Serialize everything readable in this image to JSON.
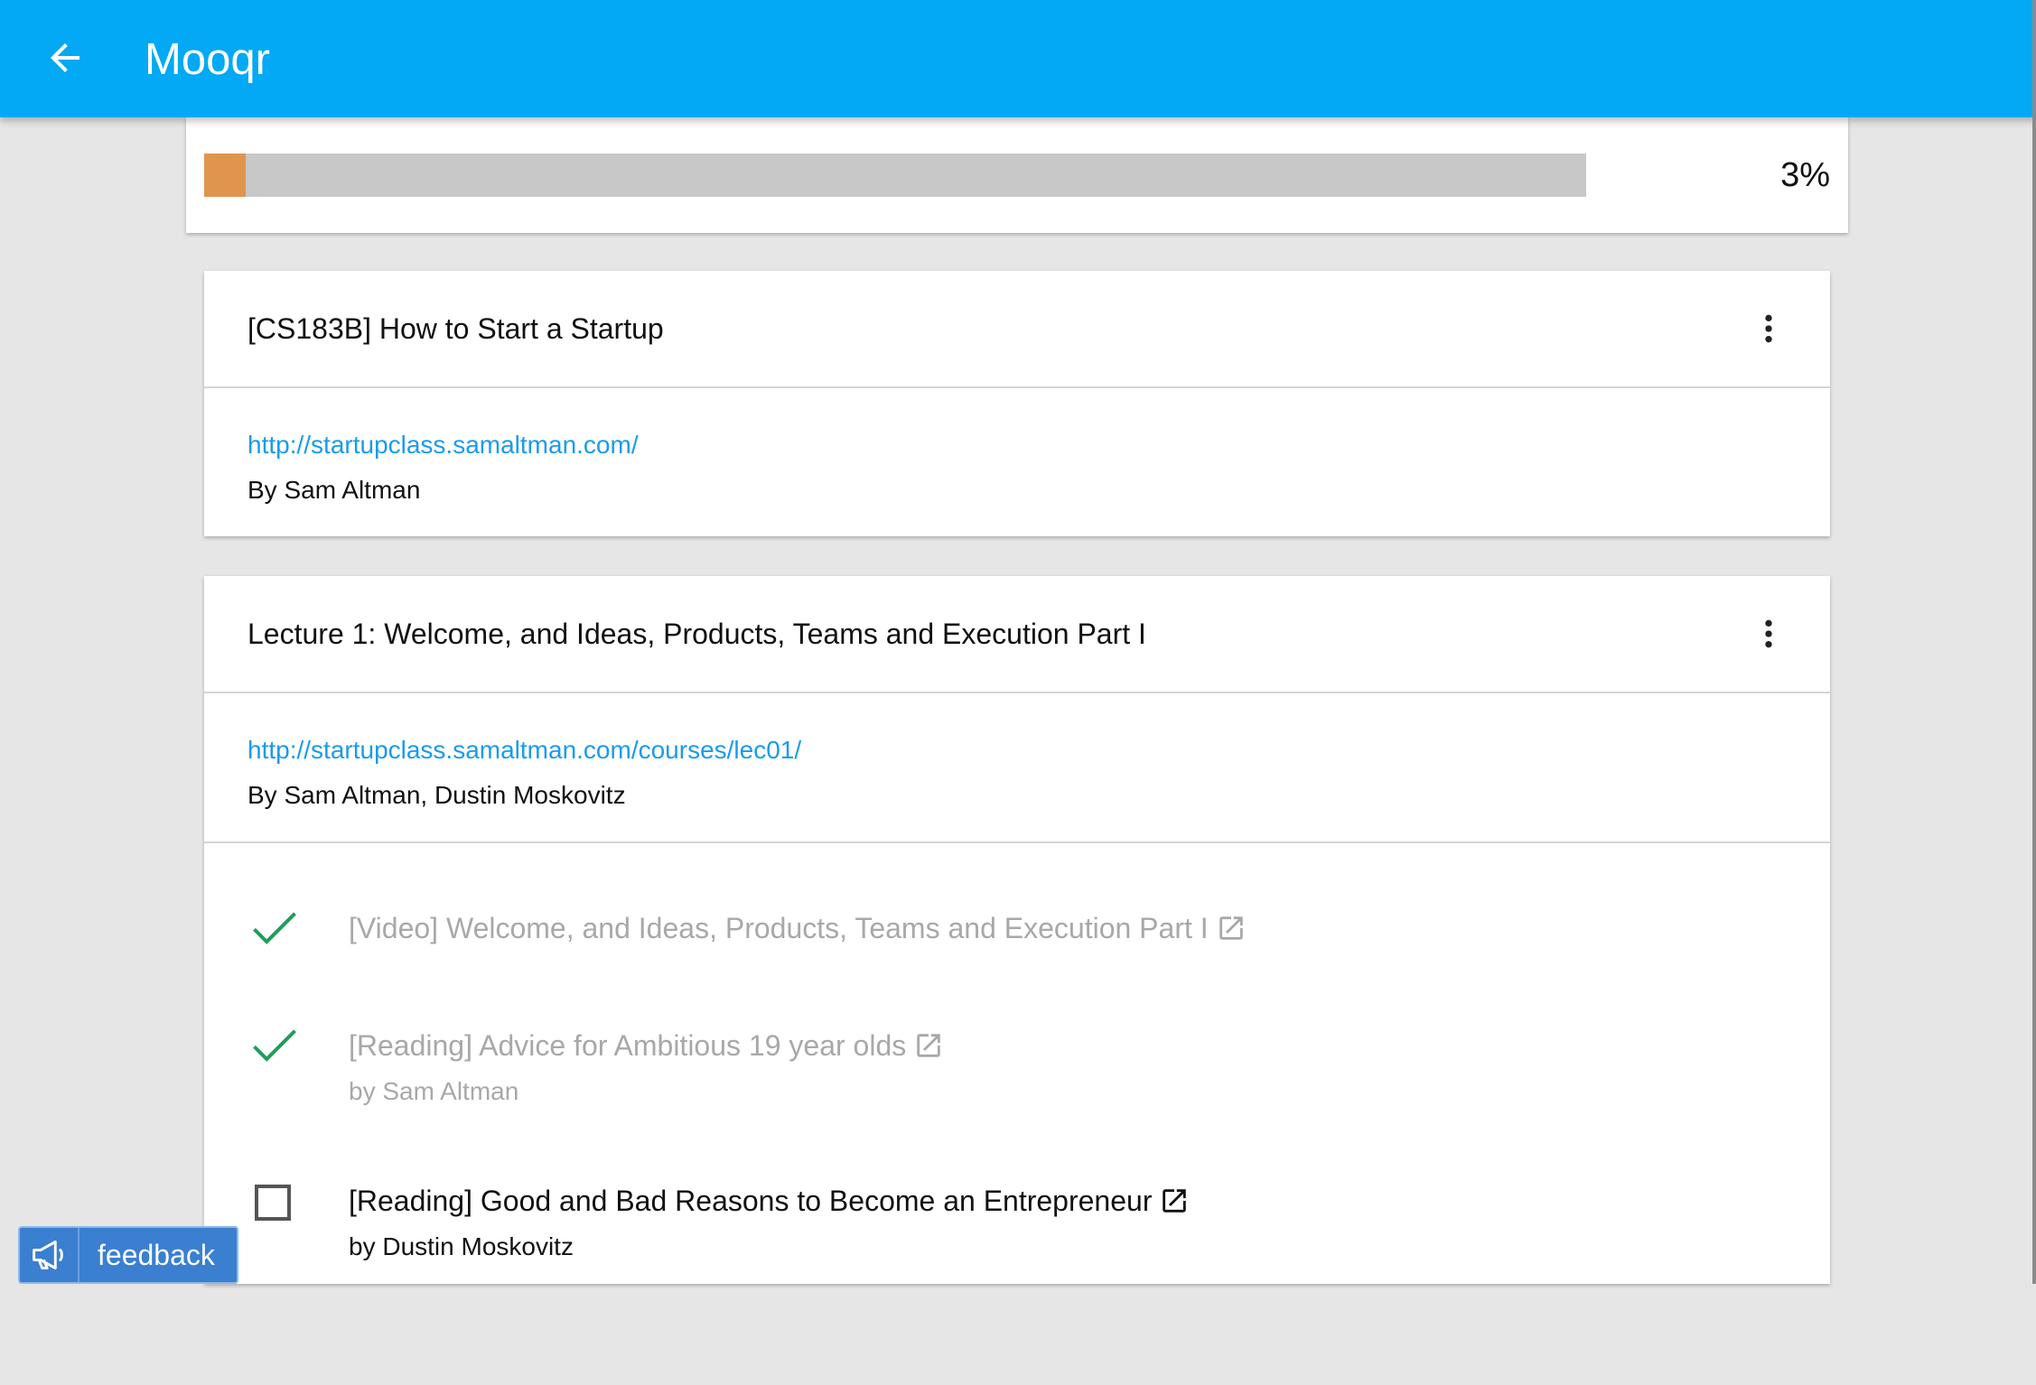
{
  "appbar": {
    "title": "Mooqr",
    "background": "#03a9f4",
    "back_icon": "arrow-back-icon"
  },
  "progress": {
    "value_percent": 3,
    "label": "3%",
    "fill_color": "#e0954e",
    "track_color": "#c8c8c8"
  },
  "course": {
    "title": "[CS183B] How to Start a Startup",
    "link": "http://startupclass.samaltman.com/",
    "author": "By Sam Altman",
    "menu_icon": "more-vert-icon"
  },
  "lecture": {
    "title": "Lecture 1: Welcome, and Ideas, Products, Teams and Execution Part I",
    "link": "http://startupclass.samaltman.com/courses/lec01/",
    "author": "By Sam Altman, Dustin Moskovitz",
    "menu_icon": "more-vert-icon",
    "items": [
      {
        "title": "[Video] Welcome, and Ideas, Products, Teams and Execution Part I",
        "subtitle": "",
        "completed": true,
        "status_icon": "checkmark-icon"
      },
      {
        "title": "[Reading] Advice for Ambitious 19 year olds",
        "subtitle": "by Sam Altman",
        "completed": true,
        "status_icon": "checkmark-icon"
      },
      {
        "title": "[Reading] Good and Bad Reasons to Become an Entrepreneur",
        "subtitle": "by Dustin Moskovitz",
        "completed": false,
        "status_icon": "checkbox-unchecked-icon"
      }
    ]
  },
  "feedback": {
    "label": "feedback",
    "icon": "megaphone-icon",
    "color": "#3a7fd0"
  },
  "colors": {
    "link": "#1a9bec",
    "check": "#1e9e5a",
    "completed_text": "#a8a8a8"
  }
}
